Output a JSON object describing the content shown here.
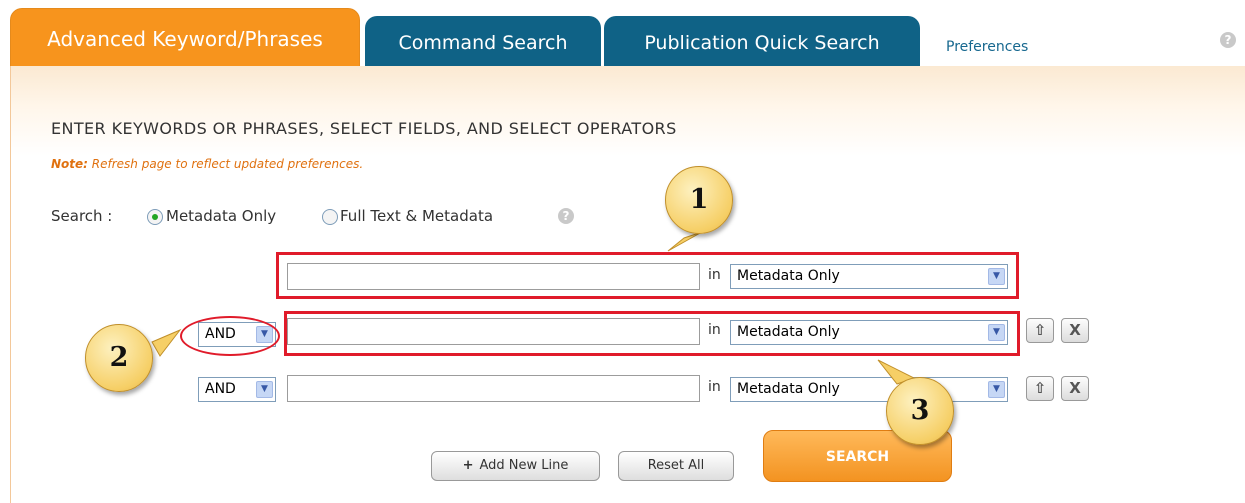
{
  "tabs": [
    {
      "label": "Advanced Keyword/Phrases"
    },
    {
      "label": "Command Search"
    },
    {
      "label": "Publication Quick Search"
    }
  ],
  "preferences_label": "Preferences",
  "help_glyph": "?",
  "heading": "ENTER KEYWORDS OR PHRASES, SELECT FIELDS, AND SELECT OPERATORS",
  "note": {
    "prefix": "Note:",
    "text": " Refresh page to reflect updated preferences."
  },
  "search_scope": {
    "label": "Search :",
    "options": [
      {
        "label": "Metadata Only",
        "selected": true
      },
      {
        "label": "Full Text & Metadata",
        "selected": false
      }
    ]
  },
  "rows": [
    {
      "operator": "",
      "term": "",
      "in_label": "in",
      "field": "Metadata Only"
    },
    {
      "operator": "AND",
      "term": "",
      "in_label": "in",
      "field": "Metadata Only"
    },
    {
      "operator": "AND",
      "term": "",
      "in_label": "in",
      "field": "Metadata Only"
    }
  ],
  "row_buttons": {
    "move_up_glyph": "⇧",
    "remove_glyph": "X"
  },
  "select_arrow_glyph": "▼",
  "buttons": {
    "add_new_line": "Add New Line",
    "add_glyph": "+",
    "reset_all": "Reset All",
    "search": "SEARCH"
  },
  "callouts": [
    "1",
    "2",
    "3"
  ],
  "colors": {
    "accent_orange": "#f7941d",
    "tab_blue": "#0f6286",
    "annotation_red": "#e01b2a"
  }
}
